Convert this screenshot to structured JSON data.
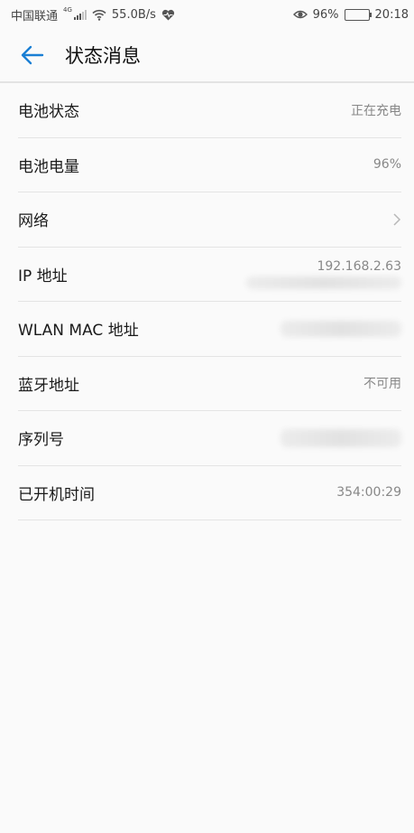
{
  "status_bar": {
    "carrier": "中国联通",
    "network_type": "4G",
    "speed": "55.0B/s",
    "battery_percent": "96%",
    "time": "20:18"
  },
  "header": {
    "title": "状态消息"
  },
  "rows": [
    {
      "label": "电池状态",
      "value": "正在充电"
    },
    {
      "label": "电池电量",
      "value": "96%"
    },
    {
      "label": "网络",
      "value": ""
    },
    {
      "label": "IP 地址",
      "value": "192.168.2.63"
    },
    {
      "label": "WLAN MAC 地址",
      "value": ""
    },
    {
      "label": "蓝牙地址",
      "value": "不可用"
    },
    {
      "label": "序列号",
      "value": ""
    },
    {
      "label": "已开机时间",
      "value": "354:00:29"
    }
  ],
  "colors": {
    "accent": "#1a7fd4",
    "divider": "#e4e4e4",
    "secondary_text": "#888888"
  },
  "icons": [
    "signal-icon",
    "wifi-icon",
    "heart-icon",
    "eye-icon",
    "battery-icon",
    "back-arrow-icon",
    "chevron-right-icon"
  ]
}
